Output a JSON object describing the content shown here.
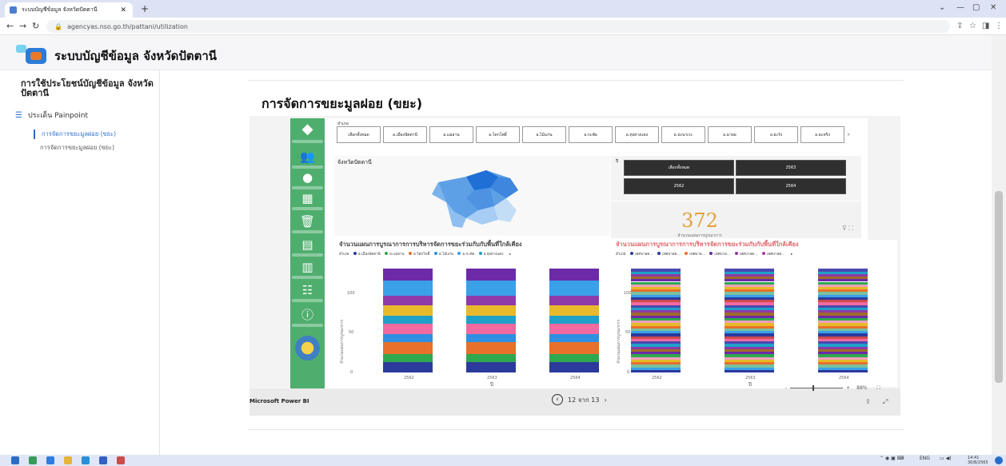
{
  "browser": {
    "tab_title": "ระบบบัญชีข้อมูล จังหวัดปัตตานี",
    "url": "agencyas.nso.go.th/pattani/utilization"
  },
  "site": {
    "title": "ระบบบัญชีข้อมูล จังหวัดปัตตานี"
  },
  "sidebar": {
    "title": "การใช้ประโยชน์บัญชีข้อมูล จังหวัดปัตตานี",
    "section": "ประเด็น Painpoint",
    "links": [
      {
        "label": "การจัดการขยะมูลฝอย (ขยะ)"
      },
      {
        "label": "การจัดการขยะมูลฝอย (ขยะ)"
      }
    ]
  },
  "main": {
    "title": "การจัดการขยะมูลฝอย (ขยะ)"
  },
  "report": {
    "slicer_label": "อำเภอ",
    "slicer_options": [
      "เลือกทั้งหมด",
      "อ.เมืองปัตตานี",
      "อ.แม่ลาน",
      "อ.โคกโพธิ์",
      "อ.ไม้แก่น",
      "อ.กะพ้อ",
      "อ.ทุ่งยางแดง",
      "อ.ปะนาเระ",
      "อ.มายอ",
      "อ.ยะรัง",
      "อ.ยะหริ่ง"
    ],
    "map_title": "จังหวัดปัตตานี",
    "year_label": "ปี",
    "years": [
      "เลือกทั้งหมด",
      "2563",
      "2562",
      "2564"
    ],
    "kpi": {
      "value": "372",
      "label": "จำนวนแผนการบูรณาการ"
    },
    "chart_left": {
      "title": "จำนวนแผนการบูรณาการการบริหารจัดการขยะร่วมกับกับพื้นที่ใกล้เคียง",
      "legend_label": "อำเภอ",
      "legend": [
        "อ.เมืองปัตตานี",
        "อ.แม่ลาน",
        "อ.โคกโพธิ์",
        "อ.ไม้แก่น",
        "อ.กะพ้อ",
        "อ.ทุ่งยางแดง"
      ],
      "ylabel": "จำนวนแผนการบูรณาการ",
      "xlabel": "ปี",
      "yticks": [
        "0",
        "50",
        "100"
      ],
      "categories": [
        "2562",
        "2563",
        "2564"
      ]
    },
    "chart_right": {
      "title": "จำนวนแผนการบูรณาการการบริหารจัดการขยะร่วมกับกับพื้นที่ใกล้เคียง",
      "legend_label": "อำเภอ",
      "legend": [
        "เทศบาลต...",
        "เทศบาลต...",
        "เทศบาล...",
        "เทศบาล...",
        "เทศบาลต...",
        "เทศบาลต..."
      ],
      "ylabel": "จำนวนแผนการบูรณาการ",
      "xlabel": "ปี",
      "yticks": [
        "0",
        "50",
        "100"
      ],
      "categories": [
        "2562",
        "2563",
        "2564"
      ]
    },
    "footer": {
      "brand": "Microsoft Power BI",
      "page": "12 จาก 13",
      "zoom": "88%"
    }
  },
  "chart_data": [
    {
      "type": "bar",
      "stacked": true,
      "categories": [
        "2562",
        "2563",
        "2564"
      ],
      "series": [
        {
          "name": "อ.เมืองปัตตานี",
          "values": [
            12,
            12,
            12
          ]
        },
        {
          "name": "อ.แม่ลาน",
          "values": [
            10,
            10,
            10
          ]
        },
        {
          "name": "อ.โคกโพธิ์",
          "values": [
            14,
            14,
            14
          ]
        },
        {
          "name": "อ.ไม้แก่น",
          "values": [
            10,
            10,
            10
          ]
        },
        {
          "name": "อ.กะพ้อ",
          "values": [
            12,
            12,
            12
          ]
        },
        {
          "name": "อ.ทุ่งยางแดง",
          "values": [
            10,
            10,
            10
          ]
        },
        {
          "values": [
            12,
            12,
            12
          ]
        },
        {
          "values": [
            12,
            12,
            12
          ]
        },
        {
          "values": [
            18,
            18,
            18
          ]
        },
        {
          "values": [
            14,
            14,
            14
          ]
        }
      ],
      "ylim": [
        0,
        130
      ]
    },
    {
      "type": "bar",
      "stacked": true,
      "categories": [
        "2562",
        "2563",
        "2564"
      ],
      "series_count": 40,
      "totals": [
        124,
        124,
        124
      ],
      "ylim": [
        0,
        130
      ]
    }
  ],
  "colors": {
    "nav_green": "#4fae6e",
    "kpi_gold": "#e0a23a",
    "accent_blue": "#2a6dc8"
  },
  "taskbar": {
    "lang": "ENG",
    "time": "14:41",
    "date": "30/8/2565"
  }
}
